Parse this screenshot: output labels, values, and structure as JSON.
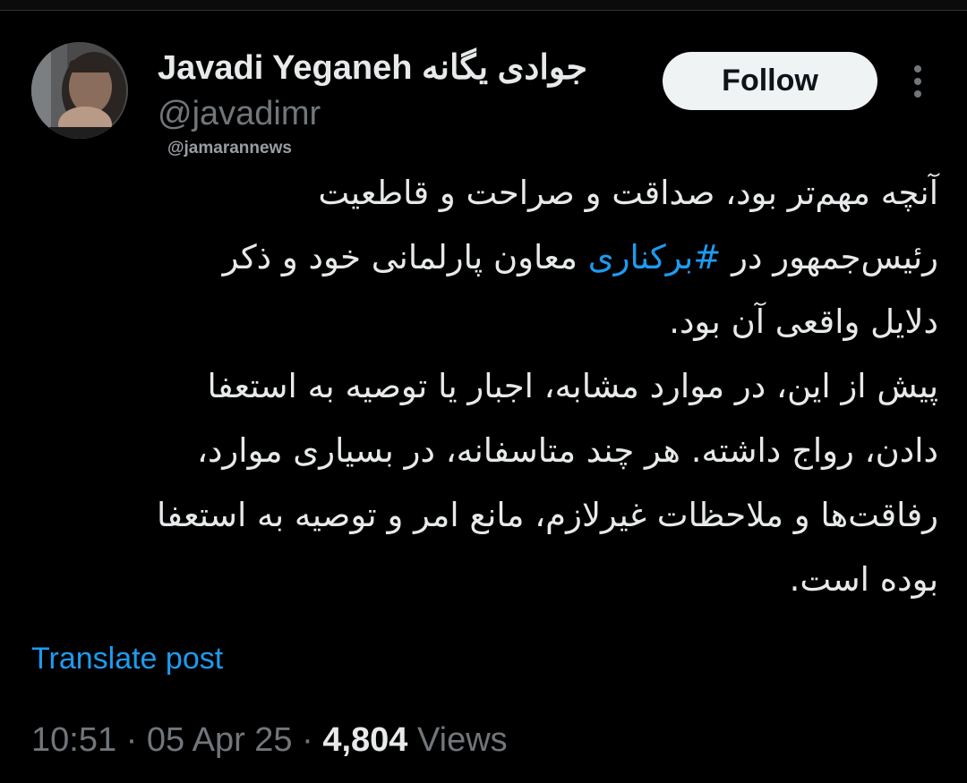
{
  "author": {
    "display_name": "Javadi Yeganeh",
    "display_name_fa": "جوادی یگانه",
    "handle": "@javadimr",
    "avatar_icon": "profile-photo",
    "watermark": "@jamarannews"
  },
  "actions": {
    "follow_label": "Follow",
    "more_icon": "more-vertical-icon"
  },
  "tweet": {
    "line_1": "آنچه مهم‌تر بود، صداقت و صراحت و قاطعیت",
    "line_2_start": "رئیس‌جمهور در ",
    "hashtag": "#برکناری",
    "line_2_end": " معاون پارلمانی خود و ذکر",
    "line_3": "دلایل واقعی آن بود.",
    "line_4": "پیش از این، در موارد مشابه، اجبار یا توصیه به استعفا",
    "line_5": "دادن، رواج داشته. هر چند متاسفانه، در بسیاری موارد،",
    "line_6": "رفاقت‌ها و ملاحظات غیرلازم، مانع امر و توصیه به استعفا",
    "line_7": "بوده است."
  },
  "translate_label": "Translate post",
  "meta": {
    "time": "10:51",
    "separator": "·",
    "date": "05 Apr 25",
    "views_count": "4,804",
    "views_label": "Views"
  },
  "colors": {
    "background": "#000000",
    "text_primary": "#e7e9ea",
    "text_secondary": "#71767b",
    "accent_link": "#1d9bf0",
    "follow_button_bg": "#eff3f4"
  }
}
